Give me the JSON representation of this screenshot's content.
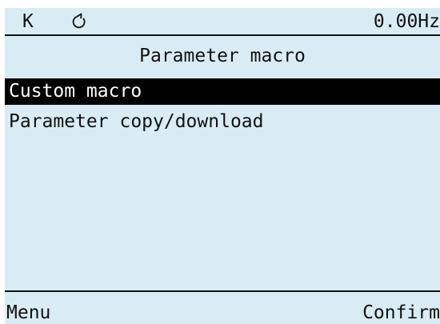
{
  "colors": {
    "screen_background": "#d9ecf3",
    "text": "#111111",
    "selected_background": "#000000",
    "selected_text": "#ffffff"
  },
  "status_bar": {
    "mode": "K",
    "rotation_icon": "rotate-clockwise-icon",
    "frequency": "0.00Hz"
  },
  "title": "Parameter macro",
  "menu": {
    "items": [
      {
        "label": "Custom macro",
        "selected": true
      },
      {
        "label": "Parameter copy/download",
        "selected": false
      }
    ]
  },
  "soft_keys": {
    "left": "Menu",
    "right": "Confirm"
  }
}
